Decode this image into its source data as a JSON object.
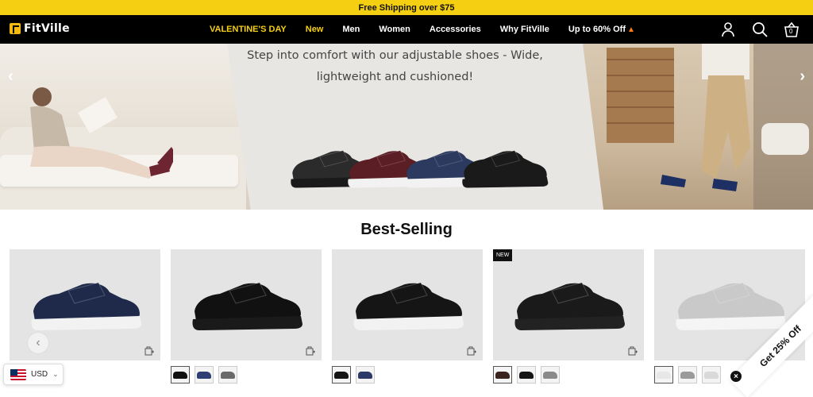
{
  "promo_bar": {
    "text": "Free Shipping over $75"
  },
  "header": {
    "logo": "FitVille",
    "nav": [
      {
        "label": "VALENTINE'S DAY",
        "style": "gold"
      },
      {
        "label": "New",
        "style": "gold"
      },
      {
        "label": "Men"
      },
      {
        "label": "Women"
      },
      {
        "label": "Accessories"
      },
      {
        "label": "Why FitVille"
      },
      {
        "label": "Up to 60% Off"
      }
    ],
    "icons": [
      "account-icon",
      "search-icon",
      "cart-icon"
    ],
    "cart_count": "0"
  },
  "hero": {
    "headline_line1": "Step into comfort with our adjustable shoes - Wide,",
    "headline_line2": "lightweight and cushioned!",
    "prev_arrow": "‹",
    "next_arrow": "›",
    "shoe_colors": [
      "#2b2b2b",
      "#5b1e25",
      "#2b3a5e",
      "#1a1a1a"
    ]
  },
  "best_selling": {
    "title": "Best-Selling",
    "products": [
      {
        "badge": "",
        "shoe_color": "#1f2a4a",
        "sole": "#f2f2f2",
        "swatches": []
      },
      {
        "badge": "",
        "shoe_color": "#111111",
        "sole": "#1a1a1a",
        "swatches": [
          "#111111",
          "#2d3f73",
          "#6a6a6a"
        ]
      },
      {
        "badge": "",
        "shoe_color": "#151515",
        "sole": "#f2f2f2",
        "swatches": [
          "#151515",
          "#2b3a66"
        ]
      },
      {
        "badge": "NEW",
        "shoe_color": "#1a1a1a",
        "sole": "#222222",
        "swatches": [
          "#3b2420",
          "#151515",
          "#8a8a8a"
        ]
      },
      {
        "badge": "",
        "shoe_color": "#c9c9c9",
        "sole": "#f5f5f5",
        "swatches": [
          "#e7e7e7",
          "#9a9a9a",
          "#d9d9d9"
        ]
      }
    ],
    "prev_arrow": "‹",
    "next_arrow": "›"
  },
  "currency": {
    "label": "USD"
  },
  "discount_ribbon": {
    "label": "Get 25% Off",
    "close": "×"
  }
}
